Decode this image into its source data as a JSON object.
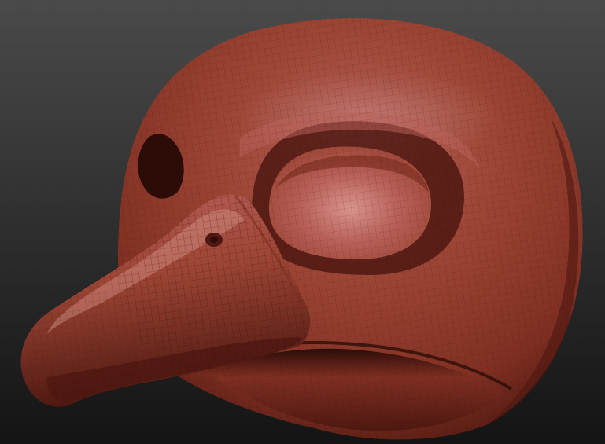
{
  "scene": {
    "subject_icon": "sculpt-head-icon",
    "background_colors": {
      "top": "#4a4a4a",
      "bottom": "#141414"
    },
    "material_colors": {
      "highlight": "#d8958a",
      "light": "#b8605a",
      "base": "#9c4535",
      "mid": "#7f2f22",
      "shadow": "#4e1810",
      "deep": "#2c0c07",
      "wire": "#3a0f08"
    }
  }
}
